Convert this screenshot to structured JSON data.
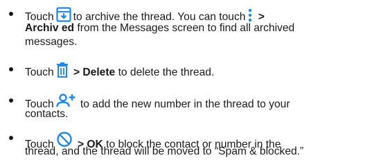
{
  "icons": {
    "archive": "archive-icon",
    "more": "more-vertical-icon",
    "delete": "trash-icon",
    "add_contact": "add-contact-icon",
    "block": "block-icon",
    "accent_color": "#1e88e5",
    "text_color": "#1a1a1a"
  },
  "items": [
    {
      "touch": "Touch",
      "after_archive": "to archive the thread. You can touch",
      "menu_sep": ">",
      "archived_label": "Archiv ed",
      "line2_rest": "from the Messages screen to find all archived",
      "line3": "messages."
    },
    {
      "touch": "Touch",
      "delete_label": "> Delete",
      "rest": "to delete the thread."
    },
    {
      "touch": "Touch",
      "rest": "to add the new number in the thread to your",
      "line2": "contacts."
    },
    {
      "touch": "Touch",
      "ok_label": "> OK",
      "rest": "to block the contact or number in the",
      "line2": "thread, and the thread will be moved to “Spam & blocked.”"
    }
  ]
}
